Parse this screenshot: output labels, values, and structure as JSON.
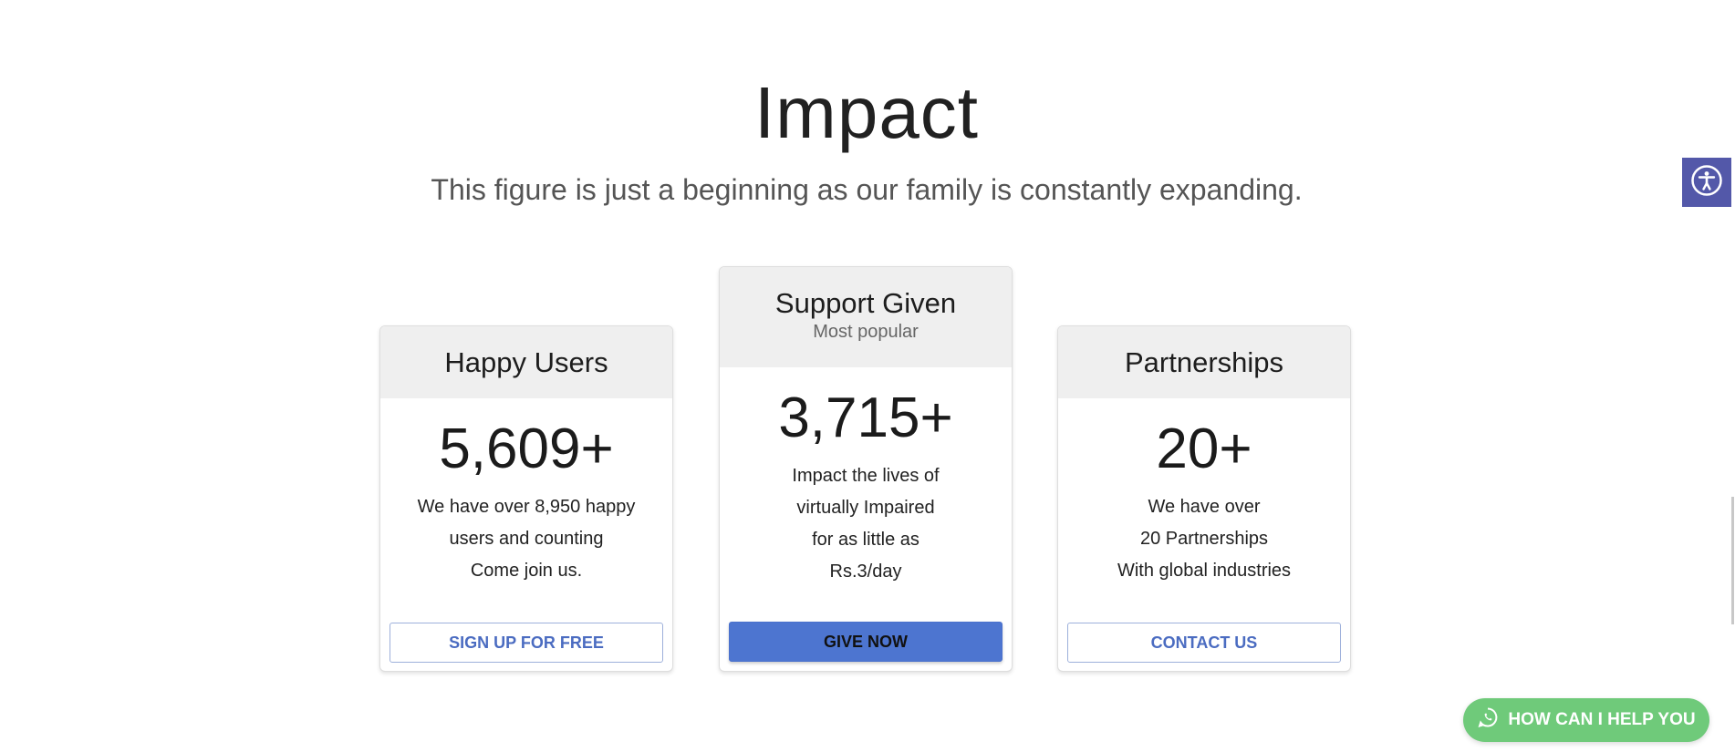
{
  "section": {
    "title": "Impact",
    "subtitle": "This figure is just a beginning as our family is constantly expanding."
  },
  "cards": [
    {
      "title": "Happy Users",
      "value": "5,609+",
      "description": [
        "We have over 8,950 happy",
        "users and counting",
        "Come join us."
      ],
      "button": "SIGN UP FOR FREE"
    },
    {
      "title": "Support Given",
      "subtitle": "Most popular",
      "value": "3,715+",
      "description": [
        "Impact the lives of",
        "virtually Impaired",
        "for as little as",
        "Rs.3/day"
      ],
      "button": "GIVE NOW"
    },
    {
      "title": "Partnerships",
      "value": "20+",
      "description": [
        "We have over",
        "20 Partnerships",
        "With global industries"
      ],
      "button": "CONTACT US"
    }
  ],
  "floating": {
    "help_label": "HOW CAN I HELP YOU",
    "help_icon": "whatsapp-icon",
    "accessibility_icon": "accessibility-icon"
  },
  "colors": {
    "accent": "#4d75d0",
    "accessibility_bg": "#5358a9",
    "help_bg": "#6fca7a",
    "card_header_bg": "#efefef"
  }
}
